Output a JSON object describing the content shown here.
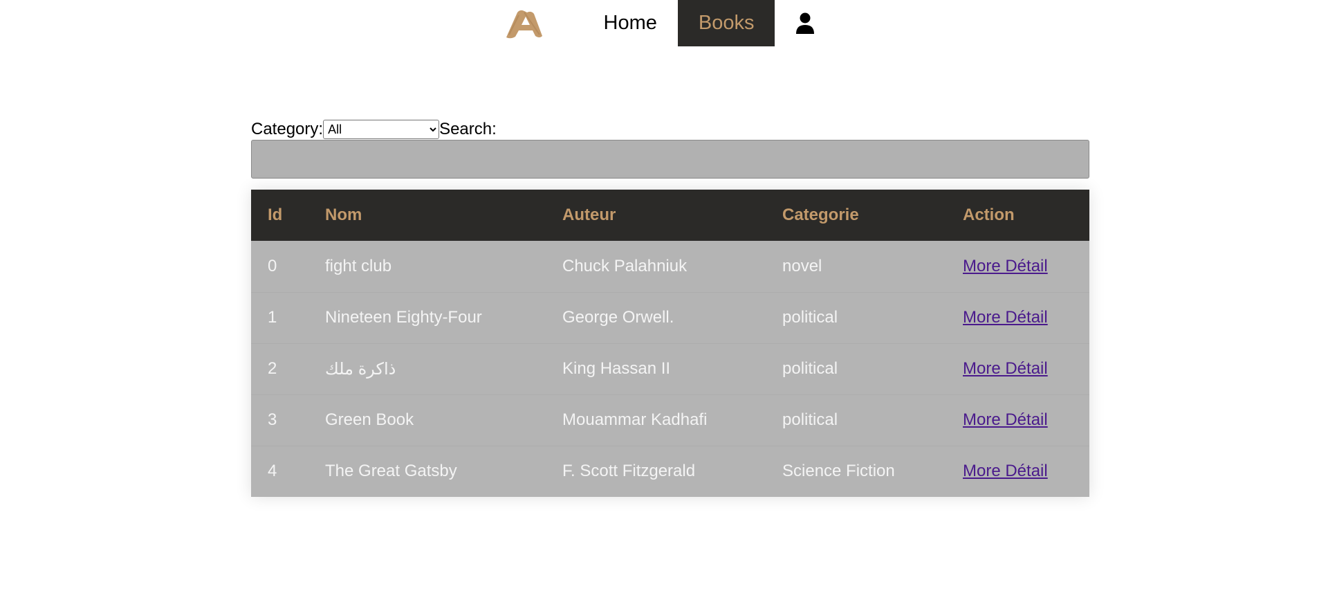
{
  "nav": {
    "logo_icon": "brand-a-logo",
    "home_label": "Home",
    "books_label": "Books",
    "user_icon": "user-icon",
    "active_color": "#c39a6b"
  },
  "filters": {
    "category_label": "Category:",
    "category_selected": "All",
    "search_label": "Search:",
    "search_value": ""
  },
  "table": {
    "headers": {
      "id": "Id",
      "nom": "Nom",
      "auteur": "Auteur",
      "categorie": "Categorie",
      "action": "Action"
    },
    "rows": [
      {
        "id": "0",
        "nom": "fight club",
        "auteur": "Chuck Palahniuk",
        "categorie": "novel",
        "action": "More Détail"
      },
      {
        "id": "1",
        "nom": "Nineteen Eighty-Four",
        "auteur": "George Orwell.",
        "categorie": "political",
        "action": "More Détail"
      },
      {
        "id": "2",
        "nom": "ذاكرة ملك",
        "auteur": "King Hassan II",
        "categorie": "political",
        "action": "More Détail"
      },
      {
        "id": "3",
        "nom": "Green Book",
        "auteur": "Mouammar Kadhafi",
        "categorie": "political",
        "action": "More Détail"
      },
      {
        "id": "4",
        "nom": "The Great Gatsby",
        "auteur": "F. Scott Fitzgerald",
        "categorie": "Science Fiction",
        "action": "More Détail"
      }
    ]
  }
}
